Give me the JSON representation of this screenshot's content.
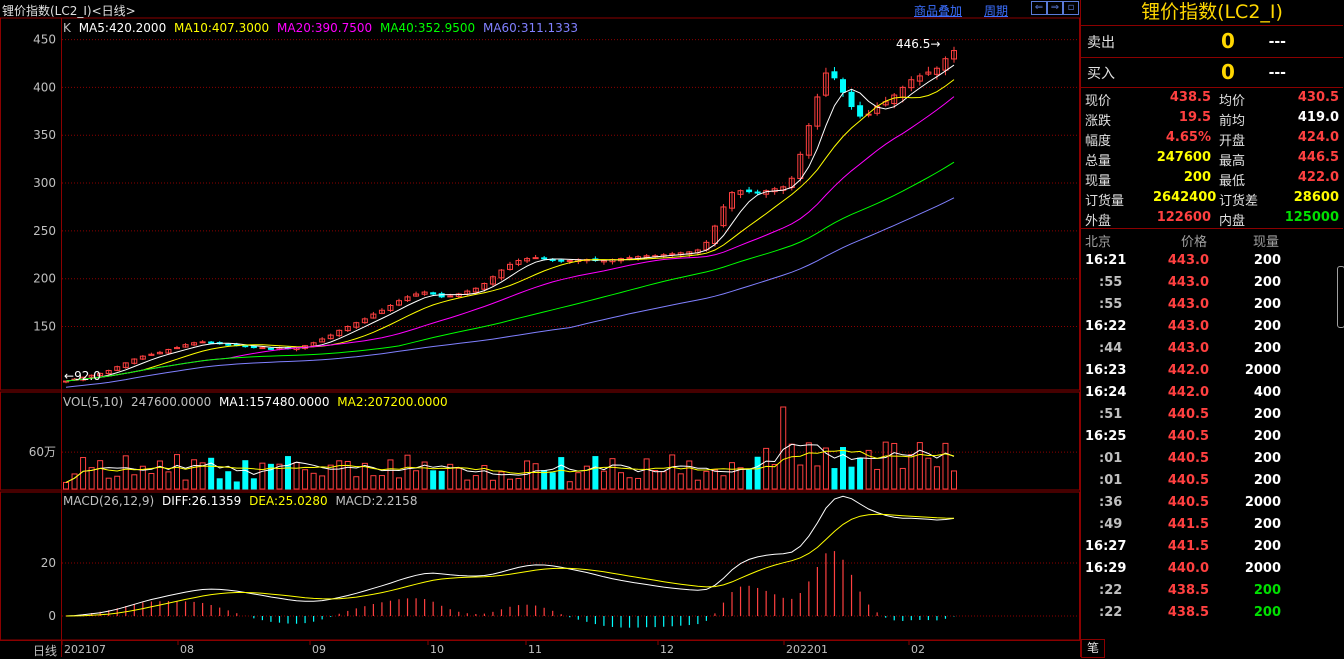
{
  "header": {
    "title": "锂价指数(LC2_I)<日线>",
    "links": [
      "商品叠加",
      "周期"
    ]
  },
  "legend_main": {
    "label": "K",
    "ma5": "MA5:420.2000",
    "ma10": "MA10:407.3000",
    "ma20": "MA20:390.7500",
    "ma40": "MA40:352.9500",
    "ma60": "MA60:311.1333"
  },
  "legend_vol": {
    "label": "VOL(5,10)",
    "vol": "247600.0000",
    "ma1": "MA1:157480.0000",
    "ma2": "MA2:207200.0000"
  },
  "legend_macd": {
    "label": "MACD(26,12,9)",
    "diff": "DIFF:26.1359",
    "dea": "DEA:25.0280",
    "macd": "MACD:2.2158"
  },
  "annotations": {
    "high": "446.5",
    "low": "92.0",
    "period_label": "日线"
  },
  "colors": {
    "bg": "#000000",
    "up": "#ff4040",
    "down": "#00ffff",
    "ma5": "#ffffff",
    "ma10": "#ffff00",
    "ma20": "#ff00ff",
    "ma40": "#00ff00",
    "ma60": "#8080ff",
    "grid": "#8b0000",
    "axis_text": "#c0c0c0"
  },
  "chart_data": {
    "type": "candlestick",
    "y_ticks": [
      150,
      200,
      250,
      300,
      350,
      400,
      450
    ],
    "ylim": [
      92,
      460
    ],
    "vol_ticks": [
      "60万"
    ],
    "macd_ticks": [
      0,
      20
    ],
    "x_labels": [
      "202107",
      "08",
      "09",
      "10",
      "11",
      "12",
      "202201",
      "02"
    ],
    "close": [
      93,
      95,
      97,
      99,
      101,
      104,
      108,
      112,
      116,
      119,
      121,
      123,
      126,
      128,
      131,
      133,
      134,
      133,
      132,
      131,
      130,
      129,
      128,
      128,
      127,
      128,
      127,
      128,
      130,
      133,
      137,
      141,
      146,
      150,
      154,
      158,
      163,
      167,
      172,
      177,
      181,
      184,
      186,
      184,
      181,
      182,
      184,
      187,
      190,
      195,
      202,
      209,
      215,
      219,
      221,
      222,
      221,
      220,
      219,
      219,
      220,
      220,
      219,
      219,
      220,
      221,
      222,
      223,
      224,
      224,
      225,
      226,
      227,
      228,
      230,
      238,
      255,
      275,
      290,
      292,
      291,
      290,
      292,
      294,
      296,
      305,
      330,
      360,
      390,
      415,
      410,
      395,
      380,
      370,
      372,
      380,
      385,
      392,
      400,
      408,
      412,
      416,
      420,
      430,
      438.5
    ],
    "ma60_end": 311.1333,
    "diff": 26.1359,
    "dea": 25.028,
    "macd": 2.2158
  },
  "quote": {
    "title": "锂价指数(LC2_I)",
    "sell_label": "卖出",
    "sell_price": "---",
    "sell_vol": "0",
    "buy_label": "买入",
    "buy_price": "---",
    "buy_vol": "0",
    "rows": [
      {
        "l1": "现价",
        "v1": "438.5",
        "c1": "red",
        "l2": "均价",
        "v2": "430.5",
        "c2": "red"
      },
      {
        "l1": "涨跌",
        "v1": "19.5",
        "c1": "red",
        "l2": "前均",
        "v2": "419.0",
        "c2": "white"
      },
      {
        "l1": "幅度",
        "v1": "4.65%",
        "c1": "red",
        "l2": "开盘",
        "v2": "424.0",
        "c2": "red"
      },
      {
        "l1": "总量",
        "v1": "247600",
        "c1": "yellow",
        "l2": "最高",
        "v2": "446.5",
        "c2": "red"
      },
      {
        "l1": "现量",
        "v1": "200",
        "c1": "yellow",
        "l2": "最低",
        "v2": "422.0",
        "c2": "red"
      },
      {
        "l1": "订货量",
        "v1": "2642400",
        "c1": "yellow",
        "l2": "订货差",
        "v2": "28600",
        "c2": "yellow"
      },
      {
        "l1": "外盘",
        "v1": "122600",
        "c1": "red",
        "l2": "内盘",
        "v2": "125000",
        "c2": "green"
      }
    ]
  },
  "ticks_table": {
    "headers": [
      "北京",
      "价格",
      "现量"
    ],
    "rows": [
      {
        "t": "16:21",
        "p": "443.0",
        "v": "200",
        "vc": "white",
        "main": true
      },
      {
        "t": ":55",
        "p": "443.0",
        "v": "200",
        "vc": "white",
        "main": false
      },
      {
        "t": ":55",
        "p": "443.0",
        "v": "200",
        "vc": "white",
        "main": false
      },
      {
        "t": "16:22",
        "p": "443.0",
        "v": "200",
        "vc": "white",
        "main": true
      },
      {
        "t": ":44",
        "p": "443.0",
        "v": "200",
        "vc": "white",
        "main": false
      },
      {
        "t": "16:23",
        "p": "442.0",
        "v": "2000",
        "vc": "white",
        "main": true
      },
      {
        "t": "16:24",
        "p": "442.0",
        "v": "400",
        "vc": "white",
        "main": true
      },
      {
        "t": ":51",
        "p": "440.5",
        "v": "200",
        "vc": "white",
        "main": false
      },
      {
        "t": "16:25",
        "p": "440.5",
        "v": "200",
        "vc": "white",
        "main": true
      },
      {
        "t": ":01",
        "p": "440.5",
        "v": "200",
        "vc": "white",
        "main": false
      },
      {
        "t": ":01",
        "p": "440.5",
        "v": "200",
        "vc": "white",
        "main": false
      },
      {
        "t": ":36",
        "p": "440.5",
        "v": "2000",
        "vc": "white",
        "main": false
      },
      {
        "t": ":49",
        "p": "441.5",
        "v": "200",
        "vc": "white",
        "main": false
      },
      {
        "t": "16:27",
        "p": "441.5",
        "v": "200",
        "vc": "white",
        "main": true
      },
      {
        "t": "16:29",
        "p": "440.0",
        "v": "2000",
        "vc": "white",
        "main": true
      },
      {
        "t": ":22",
        "p": "438.5",
        "v": "200",
        "vc": "green",
        "main": false
      },
      {
        "t": ":22",
        "p": "438.5",
        "v": "200",
        "vc": "green",
        "main": false
      }
    ],
    "footer_tab": "笔"
  }
}
